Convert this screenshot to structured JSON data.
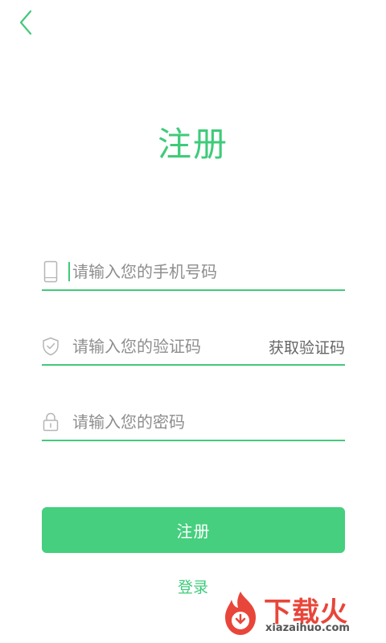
{
  "header": {
    "back_icon": "chevron-left-icon"
  },
  "title": "注册",
  "form": {
    "phone": {
      "icon": "phone-icon",
      "placeholder": "请输入您的手机号码",
      "value": ""
    },
    "code": {
      "icon": "shield-check-icon",
      "placeholder": "请输入您的验证码",
      "value": "",
      "get_code_label": "获取验证码"
    },
    "password": {
      "icon": "lock-icon",
      "placeholder": "请输入您的密码",
      "value": ""
    }
  },
  "submit_label": "注册",
  "login_label": "登录",
  "watermark": {
    "brand": "下载火",
    "url": "xiazaihuo.com"
  },
  "colors": {
    "accent": "#43c97b",
    "watermark": "#e8463a"
  }
}
